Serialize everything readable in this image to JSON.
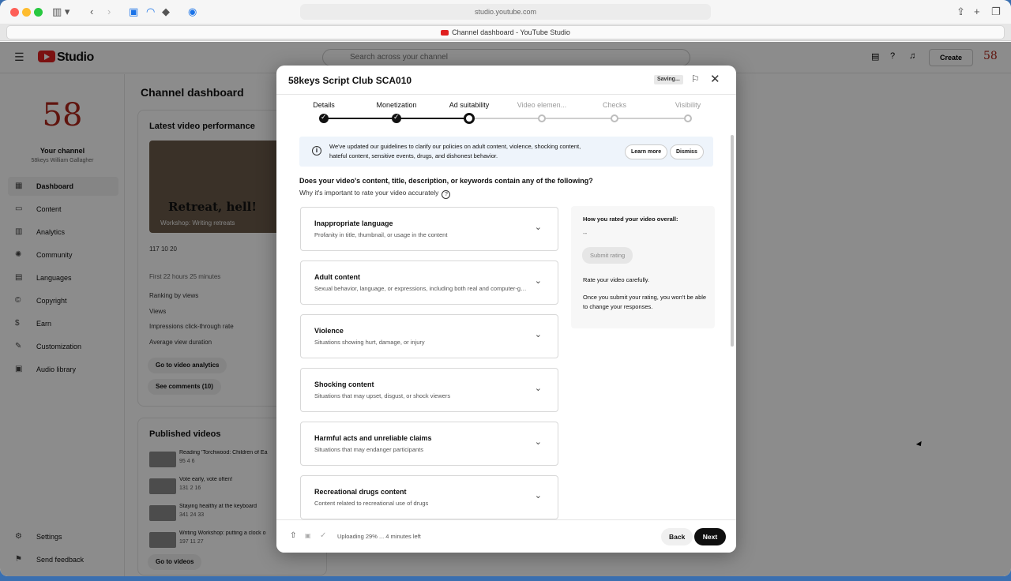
{
  "browser": {
    "url": "studio.youtube.com",
    "tab_title": "Channel dashboard - YouTube Studio"
  },
  "studio": {
    "logo_text": "Studio",
    "search_placeholder": "Search across your channel",
    "create_label": "Create",
    "header_avatar": "58",
    "channel": {
      "avatar_text": "58",
      "title": "Your channel",
      "name": "58keys William Gallagher"
    },
    "nav": [
      {
        "label": "Dashboard",
        "icon": "dashboard-icon",
        "glyph": "▦",
        "active": true
      },
      {
        "label": "Content",
        "icon": "content-icon",
        "glyph": "▭",
        "active": false
      },
      {
        "label": "Analytics",
        "icon": "analytics-icon",
        "glyph": "▥",
        "active": false
      },
      {
        "label": "Community",
        "icon": "community-icon",
        "glyph": "✺",
        "active": false
      },
      {
        "label": "Languages",
        "icon": "languages-icon",
        "glyph": "▤",
        "active": false
      },
      {
        "label": "Copyright",
        "icon": "copyright-icon",
        "glyph": "©",
        "active": false
      },
      {
        "label": "Earn",
        "icon": "earn-icon",
        "glyph": "$",
        "active": false
      },
      {
        "label": "Customization",
        "icon": "customization-icon",
        "glyph": "✎",
        "active": false
      },
      {
        "label": "Audio library",
        "icon": "audio-library-icon",
        "glyph": "▣",
        "active": false
      }
    ],
    "nav_bottom": [
      {
        "label": "Settings",
        "icon": "settings-icon",
        "glyph": "⚙"
      },
      {
        "label": "Send feedback",
        "icon": "feedback-icon",
        "glyph": "⚑"
      }
    ],
    "page_title": "Channel dashboard",
    "latest": {
      "heading": "Latest video performance",
      "thumb_title": "Retreat, hell!",
      "thumb_caption": "Workshop: Writing retreats",
      "stats": "117    10    20",
      "timeframe": "First 22 hours 25 minutes",
      "rows": [
        "Ranking by views",
        "Views",
        "Impressions click-through rate",
        "Average view duration"
      ],
      "btn_analytics": "Go to video analytics",
      "btn_comments": "See comments (10)"
    },
    "published": {
      "heading": "Published videos",
      "items": [
        {
          "title": "Reading 'Torchwood: Children of Ea",
          "stats": "95    4    6"
        },
        {
          "title": "Vote early, vote often!",
          "stats": "131    2    16"
        },
        {
          "title": "Staying healthy at the keyboard",
          "stats": "341    24    33"
        },
        {
          "title": "Writing Workshop: putting a clock o",
          "stats": "197    11    27"
        }
      ],
      "btn_videos": "Go to videos"
    }
  },
  "modal": {
    "title": "58keys Script Club SCA010",
    "saving": "Saving...",
    "steps": [
      {
        "label": "Details",
        "state": "done"
      },
      {
        "label": "Monetization",
        "state": "done"
      },
      {
        "label": "Ad suitability",
        "state": "current"
      },
      {
        "label": "Video elemen...",
        "state": "todo"
      },
      {
        "label": "Checks",
        "state": "todo"
      },
      {
        "label": "Visibility",
        "state": "todo"
      }
    ],
    "info": {
      "text": "We've updated our guidelines to clarify our policies on adult content, violence, shocking content, hateful content, sensitive events, drugs, and dishonest behavior.",
      "learn_more": "Learn more",
      "dismiss": "Dismiss"
    },
    "question": "Does your video's content, title, description, or keywords contain any of the following?",
    "why": "Why it's important to rate your video accurately",
    "categories": [
      {
        "title": "Inappropriate language",
        "desc": "Profanity in title, thumbnail, or usage in the content"
      },
      {
        "title": "Adult content",
        "desc": "Sexual behavior, language, or expressions, including both real and computer-generated"
      },
      {
        "title": "Violence",
        "desc": "Situations showing hurt, damage, or injury"
      },
      {
        "title": "Shocking content",
        "desc": "Situations that may upset, disgust, or shock viewers"
      },
      {
        "title": "Harmful acts and unreliable claims",
        "desc": "Situations that may endanger participants"
      },
      {
        "title": "Recreational drugs content",
        "desc": "Content related to recreational use of drugs"
      }
    ],
    "rating": {
      "heading": "How you rated your video overall:",
      "value": "--",
      "submit": "Submit rating",
      "note1": "Rate your video carefully.",
      "note2": "Once you submit your rating, you won't be able to change your responses."
    },
    "footer": {
      "status": "Uploading 29% ... 4 minutes left",
      "back": "Back",
      "next": "Next"
    }
  }
}
